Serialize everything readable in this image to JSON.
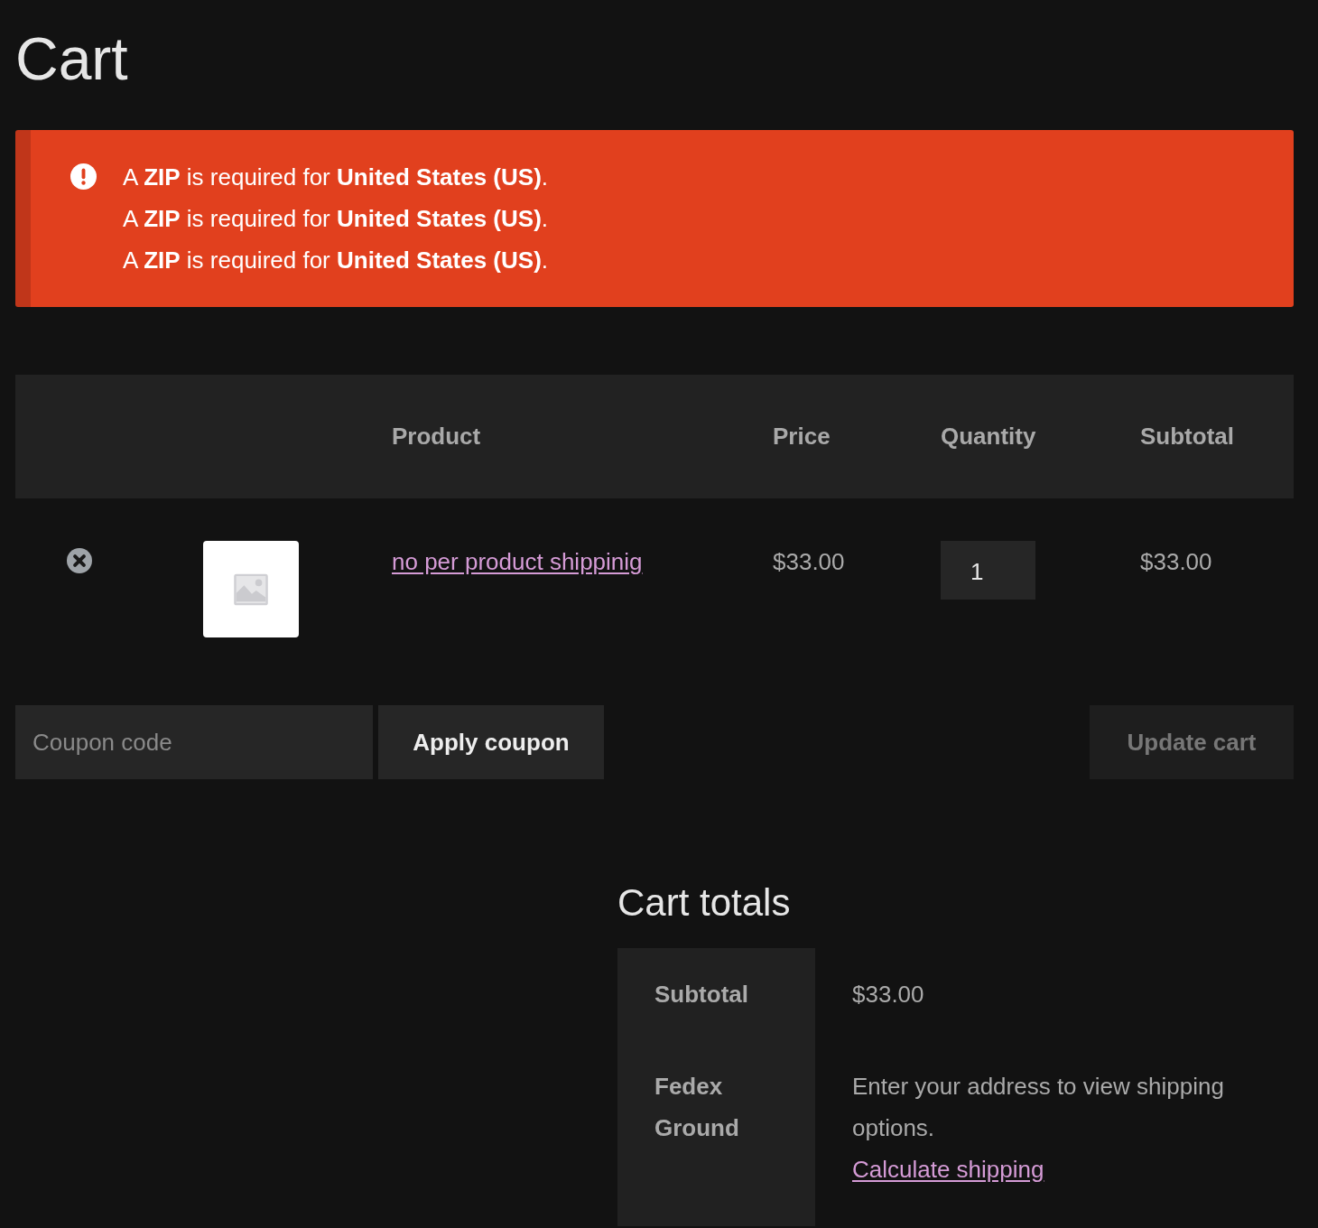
{
  "page": {
    "title": "Cart"
  },
  "notice": {
    "kind": "error",
    "messages": [
      "A **ZIP** is required for **United States (US)**.",
      "A **ZIP** is required for **United States (US)**.",
      "A **ZIP** is required for **United States (US)**."
    ]
  },
  "cart_table": {
    "columns": [
      "Product",
      "Price",
      "Quantity",
      "Subtotal"
    ],
    "rows": [
      {
        "product": "no per product shippinig",
        "price": "$33.00",
        "quantity": "1",
        "subtotal": "$33.00"
      }
    ]
  },
  "actions": {
    "coupon": {
      "placeholder": "Coupon code"
    },
    "apply_button": "Apply coupon",
    "update_button": {
      "label": "Update cart",
      "disabled": true
    }
  },
  "totals": {
    "title": "Cart totals",
    "rows": [
      {
        "kind": "amount",
        "label": "Subtotal",
        "value": "$33.00"
      },
      {
        "kind": "shipping",
        "label": "Fedex Ground",
        "value": "Enter your address to view shipping options.",
        "link": "Calculate shipping"
      }
    ]
  }
}
